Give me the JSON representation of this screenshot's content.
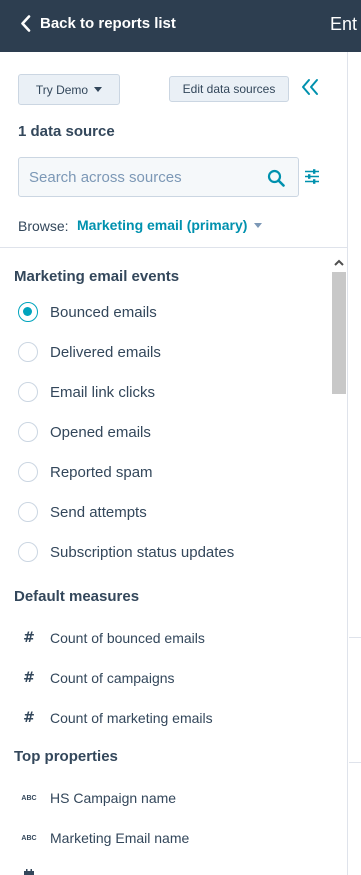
{
  "header": {
    "back_label": "Back to reports list",
    "partial_title": "Ent"
  },
  "toolbar": {
    "try_demo_label": "Try Demo",
    "edit_sources_label": "Edit data sources"
  },
  "data_source_count": "1 data source",
  "search": {
    "placeholder": "Search across sources",
    "value": ""
  },
  "browse": {
    "label": "Browse:",
    "selected": "Marketing email (primary)"
  },
  "sections": {
    "events": {
      "title": "Marketing email events",
      "items": [
        {
          "label": "Bounced emails",
          "checked": true
        },
        {
          "label": "Delivered emails",
          "checked": false
        },
        {
          "label": "Email link clicks",
          "checked": false
        },
        {
          "label": "Opened emails",
          "checked": false
        },
        {
          "label": "Reported spam",
          "checked": false
        },
        {
          "label": "Send attempts",
          "checked": false
        },
        {
          "label": "Subscription status updates",
          "checked": false
        }
      ]
    },
    "measures": {
      "title": "Default measures",
      "items": [
        {
          "label": "Count of bounced emails",
          "icon": "#"
        },
        {
          "label": "Count of campaigns",
          "icon": "#"
        },
        {
          "label": "Count of marketing emails",
          "icon": "#"
        }
      ]
    },
    "properties": {
      "title": "Top properties",
      "items": [
        {
          "label": "HS Campaign name",
          "icon": "ABC"
        },
        {
          "label": "Marketing Email name",
          "icon": "ABC"
        }
      ]
    }
  },
  "colors": {
    "header_bg": "#2d3e50",
    "accent": "#00a4bd",
    "link": "#0091ae",
    "text": "#33475b"
  },
  "icons": {
    "back": "chevron-left-icon",
    "collapse": "double-chevron-left-icon",
    "search": "search-icon",
    "filter": "sliders-icon",
    "measure": "hash-icon",
    "property": "abc-text-icon"
  }
}
